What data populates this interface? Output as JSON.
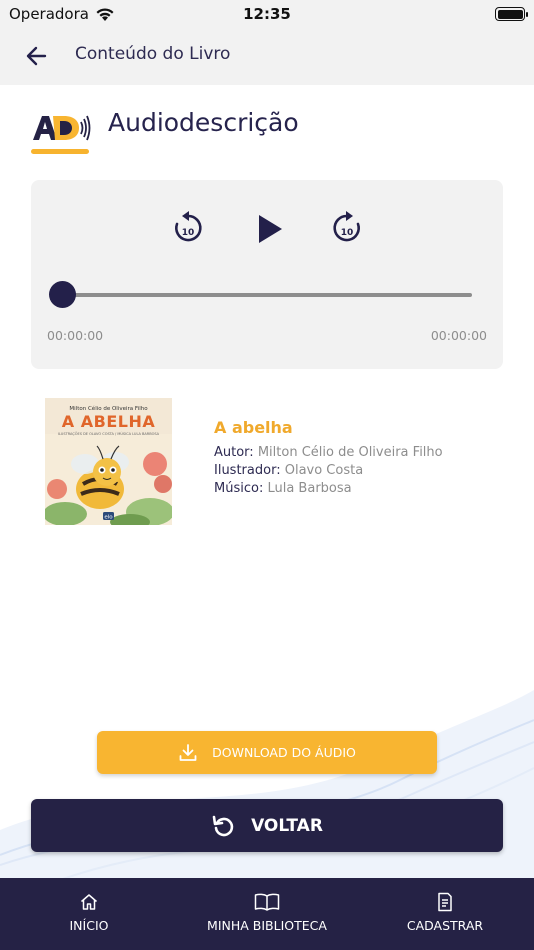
{
  "status_bar": {
    "carrier": "Operadora",
    "time": "12:35"
  },
  "app_bar": {
    "title": "Conteúdo do Livro",
    "back_icon": "arrow-left-icon"
  },
  "section": {
    "logo_text": "AD",
    "title": "Audiodescrição"
  },
  "player": {
    "rewind_seconds": "10",
    "forward_seconds": "10",
    "time_current": "00:00:00",
    "time_total": "00:00:00",
    "progress": 0
  },
  "book": {
    "cover": {
      "author_line": "Milton Célio de Oliveira Filho",
      "title": "A ABELHA",
      "subtitle": "ILUSTRAÇÕES DE OLAVO COSTA / MÚSICA LULA BARBOSA",
      "publisher": "elo"
    },
    "title": "A abelha",
    "author_label": "Autor:",
    "author": "Milton Célio de Oliveira Filho",
    "illustrator_label": "Ilustrador:",
    "illustrator": "Olavo Costa",
    "musician_label": "Músico:",
    "musician": "Lula Barbosa"
  },
  "actions": {
    "download_label": "DOWNLOAD DO ÁUDIO",
    "voltar_label": "VOLTAR"
  },
  "bottom_nav": {
    "items": [
      {
        "label": "INÍCIO",
        "icon": "home-icon"
      },
      {
        "label": "MINHA BIBLIOTECA",
        "icon": "open-book-icon"
      },
      {
        "label": "CADASTRAR",
        "icon": "document-icon"
      }
    ]
  },
  "colors": {
    "primary": "#252245",
    "accent": "#f8b531",
    "book_title": "#f0a92c",
    "muted": "#8d8d8d"
  }
}
